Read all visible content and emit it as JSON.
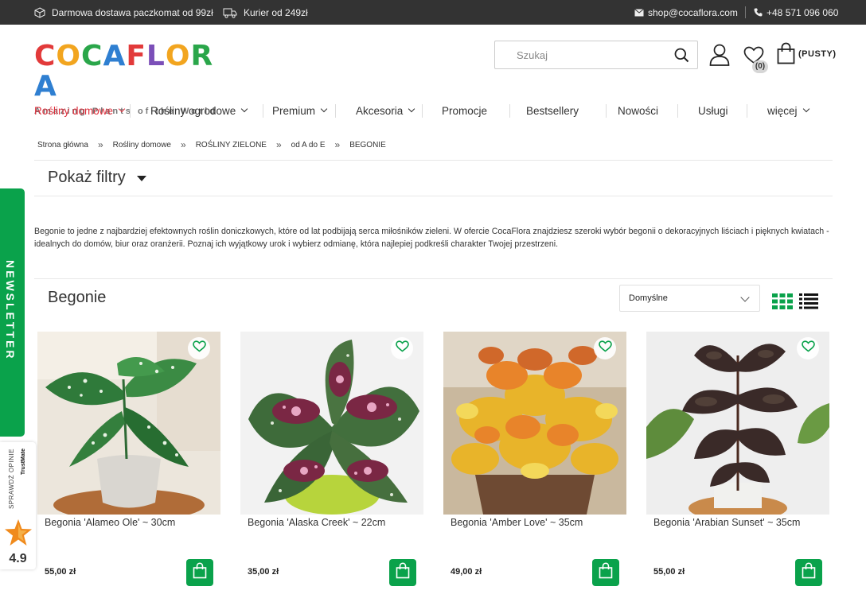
{
  "topbar": {
    "shipping_paczkomat": "Darmowa dostawa paczkomat od 99zł",
    "shipping_courier": "Kurier od 249zł",
    "email": "shop@cocaflora.com",
    "phone": "+48 571 096 060"
  },
  "logo": {
    "letters": [
      "C",
      "O",
      "C",
      "A",
      "F",
      "L",
      "O",
      "R",
      "A"
    ],
    "tagline": "Amazing Plants of the World"
  },
  "search": {
    "placeholder": "Szukaj"
  },
  "header": {
    "wishlist_count": "(0)",
    "cart_label": "(PUSTY)"
  },
  "nav": [
    {
      "label": "Rośliny domowe",
      "dropdown": true,
      "active": true
    },
    {
      "label": "Rośliny ogrodowe",
      "dropdown": true,
      "active": false
    },
    {
      "label": "Premium",
      "dropdown": true,
      "active": false
    },
    {
      "label": "Akcesoria",
      "dropdown": true,
      "active": false
    },
    {
      "label": "Promocje",
      "dropdown": false,
      "active": false
    },
    {
      "label": "Bestsellery",
      "dropdown": false,
      "active": false
    },
    {
      "label": "Nowości",
      "dropdown": false,
      "active": false
    },
    {
      "label": "Usługi",
      "dropdown": false,
      "active": false
    },
    {
      "label": "więcej",
      "dropdown": true,
      "active": false
    }
  ],
  "breadcrumb": [
    "Strona główna",
    "Rośliny domowe",
    "ROŚLINY ZIELONE",
    "od A do E",
    "BEGONIE"
  ],
  "breadcrumb_sep": "»",
  "filters": {
    "label": "Pokaż filtry"
  },
  "description": "Begonie to jedne z najbardziej efektownych roślin doniczkowych, które od lat podbijają serca miłośników zieleni. W ofercie CocaFlora znajdziesz szeroki wybór begonii o dekoracyjnych liściach i pięknych kwiatach - idealnych do domów, biur oraz oranżerii. Poznaj ich wyjątkowy urok i wybierz odmianę, która najlepiej podkreśli charakter Twojej przestrzeni.",
  "category": {
    "title": "Begonie",
    "sort_selected": "Domyślne"
  },
  "products": [
    {
      "name": "Begonia 'Alameo Ole' ~ 30cm",
      "price": "55,00 zł"
    },
    {
      "name": "Begonia 'Alaska Creek' ~ 22cm",
      "price": "35,00 zł"
    },
    {
      "name": "Begonia 'Amber Love' ~ 35cm",
      "price": "49,00 zł"
    },
    {
      "name": "Begonia 'Arabian Sunset' ~ 35cm",
      "price": "55,00 zł"
    }
  ],
  "widgets": {
    "newsletter": "NEWSLETTER",
    "trust_text": "SPRAWDŹ OPINIE",
    "trust_brand": "TrustMate",
    "trust_score": "4.9"
  },
  "colors": {
    "accent_green": "#0aa24b",
    "nav_active_red": "#e0303d",
    "topbar_bg": "#333333",
    "logo_letters": [
      "#e23a3a",
      "#f2a51f",
      "#2aa64a",
      "#2f7fd1",
      "#e23a3a",
      "#7b4fb8",
      "#f2a51f",
      "#2aa64a",
      "#2f7fd1"
    ]
  },
  "icons": {
    "topbar": [
      "box-icon",
      "truck-icon",
      "mail-icon",
      "phone-icon"
    ],
    "header": [
      "search-icon",
      "user-icon",
      "heart-icon",
      "shopping-bag-icon"
    ],
    "product": [
      "heart-icon",
      "shopping-bag-icon"
    ],
    "view": [
      "grid-view-icon",
      "list-view-icon"
    ]
  }
}
